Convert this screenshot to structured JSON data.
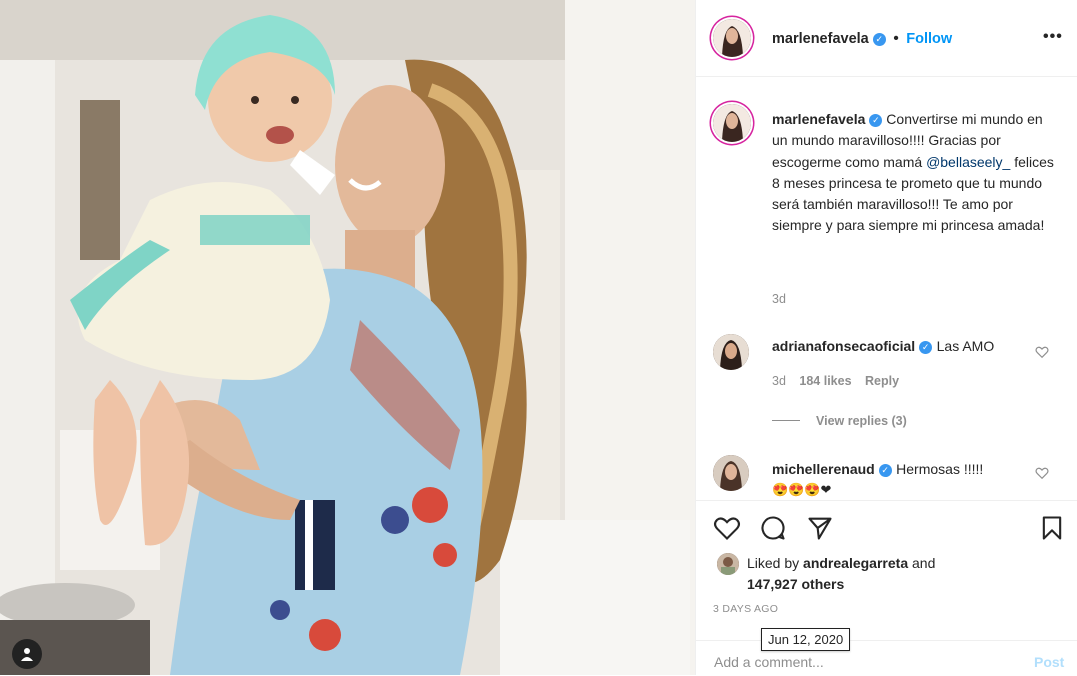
{
  "header": {
    "username": "marlenefavela",
    "dot": "•",
    "follow_label": "Follow",
    "more_icon": "ellipsis-icon"
  },
  "caption": {
    "username": "marlenefavela",
    "text_before_mention": "Convertirse mi mundo en un mundo maravilloso!!!! Gracias por escogerme como mamá",
    "mention": "@bellaseely_",
    "text_after_mention": "felices 8 meses princesa te prometo que tu mundo será también maravilloso!!! Te amo por siempre y para siempre mi princesa amada!",
    "age": "3d"
  },
  "comments": [
    {
      "username": "adrianafonsecaoficial",
      "text": "Las AMO",
      "age": "3d",
      "likes": "184 likes",
      "reply_label": "Reply",
      "view_replies": "View replies (3)"
    },
    {
      "username": "michellerenaud",
      "text": "Hermosas !!!!!",
      "emojis": "😍😍😍❤"
    }
  ],
  "actions": {
    "icons": [
      "heart-icon",
      "comment-icon",
      "share-icon",
      "bookmark-icon"
    ],
    "liked_by_prefix": "Liked by",
    "liked_by_user": "andrealegarreta",
    "liked_by_and": "and",
    "others_count": "147,927 others",
    "timestamp": "3 DAYS AGO",
    "tooltip_date": "Jun 12, 2020"
  },
  "comment_box": {
    "placeholder": "Add a comment...",
    "post_label": "Post"
  },
  "colors": {
    "accent_blue": "#0095f6",
    "verified_blue": "#3897f0",
    "muted": "#8e8e8e",
    "text": "#262626"
  }
}
